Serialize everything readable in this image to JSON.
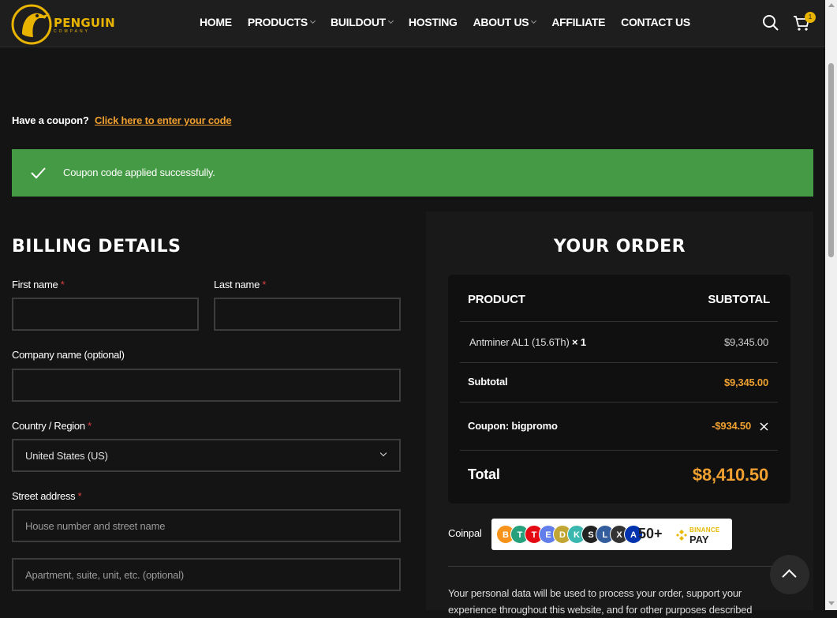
{
  "brand": {
    "name": "PENGUIN",
    "subtitle": "COMPANY",
    "accent": "#e9b400"
  },
  "nav": {
    "items": [
      {
        "label": "HOME",
        "has_dropdown": false
      },
      {
        "label": "PRODUCTS",
        "has_dropdown": true
      },
      {
        "label": "BUILDOUT",
        "has_dropdown": true
      },
      {
        "label": "HOSTING",
        "has_dropdown": false
      },
      {
        "label": "ABOUT US",
        "has_dropdown": true
      },
      {
        "label": "AFFILIATE",
        "has_dropdown": false
      },
      {
        "label": "CONTACT US",
        "has_dropdown": false
      }
    ],
    "search_icon": "search-icon",
    "cart_icon": "cart-icon",
    "cart_count": "1"
  },
  "coupon": {
    "prompt": "Have a coupon?",
    "link": "Click here to enter your code"
  },
  "notice": {
    "message": "Coupon code applied successfully.",
    "color": "#459a45"
  },
  "billing": {
    "heading": "BILLING DETAILS",
    "first_name_label": "First name",
    "last_name_label": "Last name",
    "company_label": "Company name (optional)",
    "country_label": "Country / Region",
    "country_value": "United States (US)",
    "street_label": "Street address",
    "street_placeholder": "House number and street name",
    "street2_placeholder": "Apartment, suite, unit, etc. (optional)",
    "required_mark": "*"
  },
  "order": {
    "heading": "YOUR ORDER",
    "col_product": "PRODUCT",
    "col_subtotal": "SUBTOTAL",
    "item_name": "Antminer AL1 (15.6Th)",
    "item_qty": "× 1",
    "item_price": "$9,345.00",
    "subtotal_label": "Subtotal",
    "subtotal_value": "$9,345.00",
    "coupon_label": "Coupon: bigpromo",
    "coupon_value": "-$934.50",
    "total_label": "Total",
    "total_value": "$8,410.50"
  },
  "payment": {
    "label": "Coinpal",
    "more_count": "50+",
    "binance_top": "BINANCE",
    "binance_pay": "PAY"
  },
  "privacy_text": "Your personal data will be used to process your order, support your experience throughout this website, and for other purposes described"
}
